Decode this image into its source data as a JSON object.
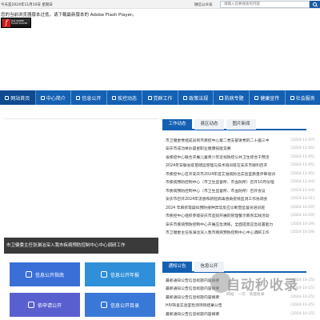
{
  "topbar": {
    "date": "今天是2024年11月10日 星期日",
    "wechat": "微信公众号",
    "search_placeholder": "请输入您要搜索的内容"
  },
  "flash": {
    "message": "您的当前浏览器版本过低，请下载最新版本的 Adobe Flash Player。",
    "logo_line1": "Get ADOBE",
    "logo_line2": "FLASH PLAYER"
  },
  "nav": {
    "items": [
      {
        "label": "网站首页",
        "active": true
      },
      {
        "label": "中心简介",
        "active": false
      },
      {
        "label": "信息公开",
        "active": false
      },
      {
        "label": "疾控动态",
        "active": false
      },
      {
        "label": "党群工作",
        "active": false
      },
      {
        "label": "政策法规",
        "active": false
      },
      {
        "label": "防病专题",
        "active": false
      },
      {
        "label": "健康宣传",
        "active": false
      },
      {
        "label": "社会服务",
        "active": false
      }
    ]
  },
  "slide": {
    "caption": "市卫健委主任张渊冶深入我市疾病预防控制中心中心调研工作"
  },
  "news_tabs": [
    {
      "label": "工作动态",
      "active": true
    },
    {
      "label": "县区动态",
      "active": false
    },
    {
      "label": "图片新闻",
      "active": false
    }
  ],
  "news": [
    {
      "title": "市卫健委党组成员到市疾控中心第二党支部讲党的二十届三中",
      "date": "[2024-11-07]"
    },
    {
      "title": "安庆市成功举办晨星职业健康技能竞赛",
      "date": "[2024-11-05]"
    },
    {
      "title": "省疾控中心联合开展儿童青少年近视防控公共卫生综合干预活",
      "date": "[2024-11-05]"
    },
    {
      "title": "2024年安徽省疫苗储运管理与技术培训班在安庆市顺利召开",
      "date": "[2024-11-05]"
    },
    {
      "title": "市疾控中心召开安庆市2024年度艾滋病防治实验室质量评审培训",
      "date": "[2024-11-05]"
    },
    {
      "title": "市疾病预防控制中心（市卫生监督所、市血防所）召开10月份理",
      "date": "[2024-11-04]"
    },
    {
      "title": "市疾病预防控制中心（市卫生监督所、市血防所）召开会议",
      "date": "[2024-11-04]"
    },
    {
      "title": "安庆市召开2024年流感和新冠病毒感染疫情监测工作协调会",
      "date": "[2024-10-31]"
    },
    {
      "title": "2024 年麻疹等疑似预防接种异常反应诊断暨监督员培训班",
      "date": "[2024-10-29]"
    },
    {
      "title": "市疾控中心组织参观安庆市监狱开展的管理警示教育实践活动",
      "date": "[2024-10-29]"
    },
    {
      "title": "安庆市疾病预防控制中心开展应急演练，全面提高应急处置能力",
      "date": "[2024-10-29]"
    },
    {
      "title": "市卫健委主任张渊冶深入我市疾病预防控制中心中心调研工作",
      "date": "[2024-10-29]"
    }
  ],
  "notice_tabs": [
    {
      "label": "通知公告",
      "active": true
    },
    {
      "label": "信息公开",
      "active": false
    }
  ],
  "notices": [
    {
      "title": "最新通知公告信息标题内容摘要",
      "date": "[2024-10-25]"
    },
    {
      "title": "最新通知公告信息标题内容摘要",
      "date": "[2024-10-25]"
    },
    {
      "title": "最新通知公告信息标题内容摘要",
      "date": "[2024-10-25]"
    },
    {
      "title": "HIV筛查实验室检测项目结果公告",
      "date": "[2024-10-25]"
    },
    {
      "title": "最新通知公告信息标题内容摘要",
      "date": "[2024-10-25]"
    }
  ],
  "tiles": [
    {
      "label": "信息公开指南",
      "color": "#3a6fd8"
    },
    {
      "label": "信息公开年报",
      "color": "#2f8fd8"
    },
    {
      "label": "依申请公开",
      "color": "#5a5fd0"
    },
    {
      "label": "信息公开目录",
      "color": "#3a78d8"
    }
  ],
  "watermark": {
    "text": "自动秒收录",
    "sub": "网站 · 一次 · 快速收录"
  }
}
